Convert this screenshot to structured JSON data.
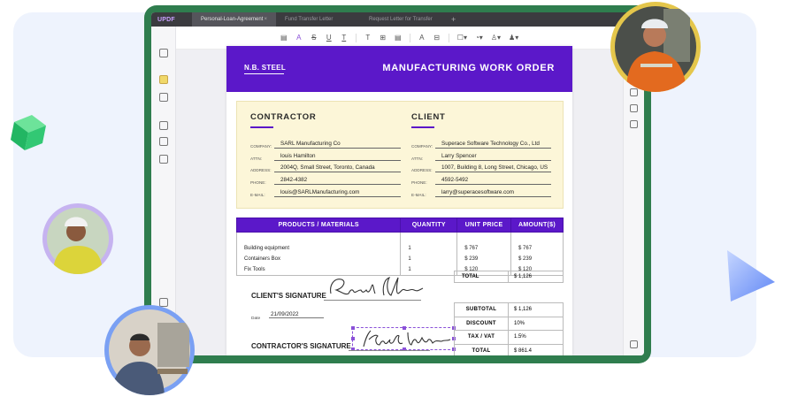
{
  "app": {
    "logo": "UPDF"
  },
  "tabs": [
    {
      "label": "Personal-Loan-Agreement",
      "close": "×",
      "active": true
    },
    {
      "label": "Fund Transfer Letter",
      "active": false
    },
    {
      "label": "Request Letter for Transfer",
      "active": false
    }
  ],
  "tab_add": "+",
  "toolbar": {
    "items": [
      "comment-icon",
      "highlight-icon",
      "strikethrough-icon",
      "underline-icon",
      "squiggly-icon",
      "text-icon",
      "textbox-icon",
      "note-icon",
      "pencil-icon",
      "eraser-icon",
      "shape-icon",
      "stamp-icon",
      "signature-icon",
      "color-icon"
    ],
    "glyphs": [
      "▤",
      "A",
      "S",
      "U",
      "T",
      "T",
      "⊞",
      "▤",
      "A",
      "⊟",
      "☐▾",
      "◔▾",
      "♙▾",
      "♟▾"
    ]
  },
  "document": {
    "brand": "N.B. STEEL",
    "title": "MANUFACTURING WORK ORDER",
    "contractor": {
      "heading": "CONTRACTOR",
      "company_label": "COMPANY:",
      "company": "SARL Manufacturing Co",
      "attn_label": "ATTN:",
      "attn": "louis Hamilton",
      "address_label": "ADDRESS:",
      "address": "2004Q, Small Street, Toronto, Canada",
      "phone_label": "PHONE:",
      "phone": "2842-4382",
      "email_label": "E-MAIL:",
      "email": "louis@SARLManufacturing.com"
    },
    "client": {
      "heading": "CLIENT",
      "company_label": "COMPANY:",
      "company": "Superace Software Technology Co., Ltd",
      "attn_label": "ATTN:",
      "attn": "Larry Spencer",
      "address_label": "ADDRESS:",
      "address": "1007, Building 8, Long Street, Chicago, US",
      "phone_label": "PHONE:",
      "phone": "4592-5492",
      "email_label": "E-MAIL:",
      "email": "larry@superacesoftware.com"
    },
    "table": {
      "headers": [
        "PRODUCTS / MATERIALS",
        "QUANTITY",
        "UNIT PRICE",
        "AMOUNT($)"
      ],
      "rows": [
        [
          "Building equipment",
          "1",
          "$ 767",
          "$ 767"
        ],
        [
          "Containers Box",
          "1",
          "$ 239",
          "$ 239"
        ],
        [
          "Fix Tools",
          "1",
          "$ 120",
          "$ 120"
        ]
      ],
      "total_label": "TOTAL",
      "total_value": "$ 1,126"
    },
    "client_signature_label": "CLIENT'S SIGNATURE",
    "client_signature": "Richard Nixon",
    "date_label": "Date",
    "date_value": "21/09/2022",
    "contractor_signature_label": "CONTRACTOR'S SIGNATURE",
    "contractor_signature": "Kristen Watson",
    "summary": [
      {
        "label": "SUBTOTAL",
        "value": "$ 1,126"
      },
      {
        "label": "DISCOUNT",
        "value": "10%"
      },
      {
        "label": "TAX / VAT",
        "value": "1.5%"
      },
      {
        "label": "TOTAL",
        "value": "$ 861.4"
      }
    ]
  },
  "colors": {
    "brand_purple": "#5b18c9",
    "device_green": "#2f7d4e",
    "info_yellow": "#fcf6d8"
  }
}
